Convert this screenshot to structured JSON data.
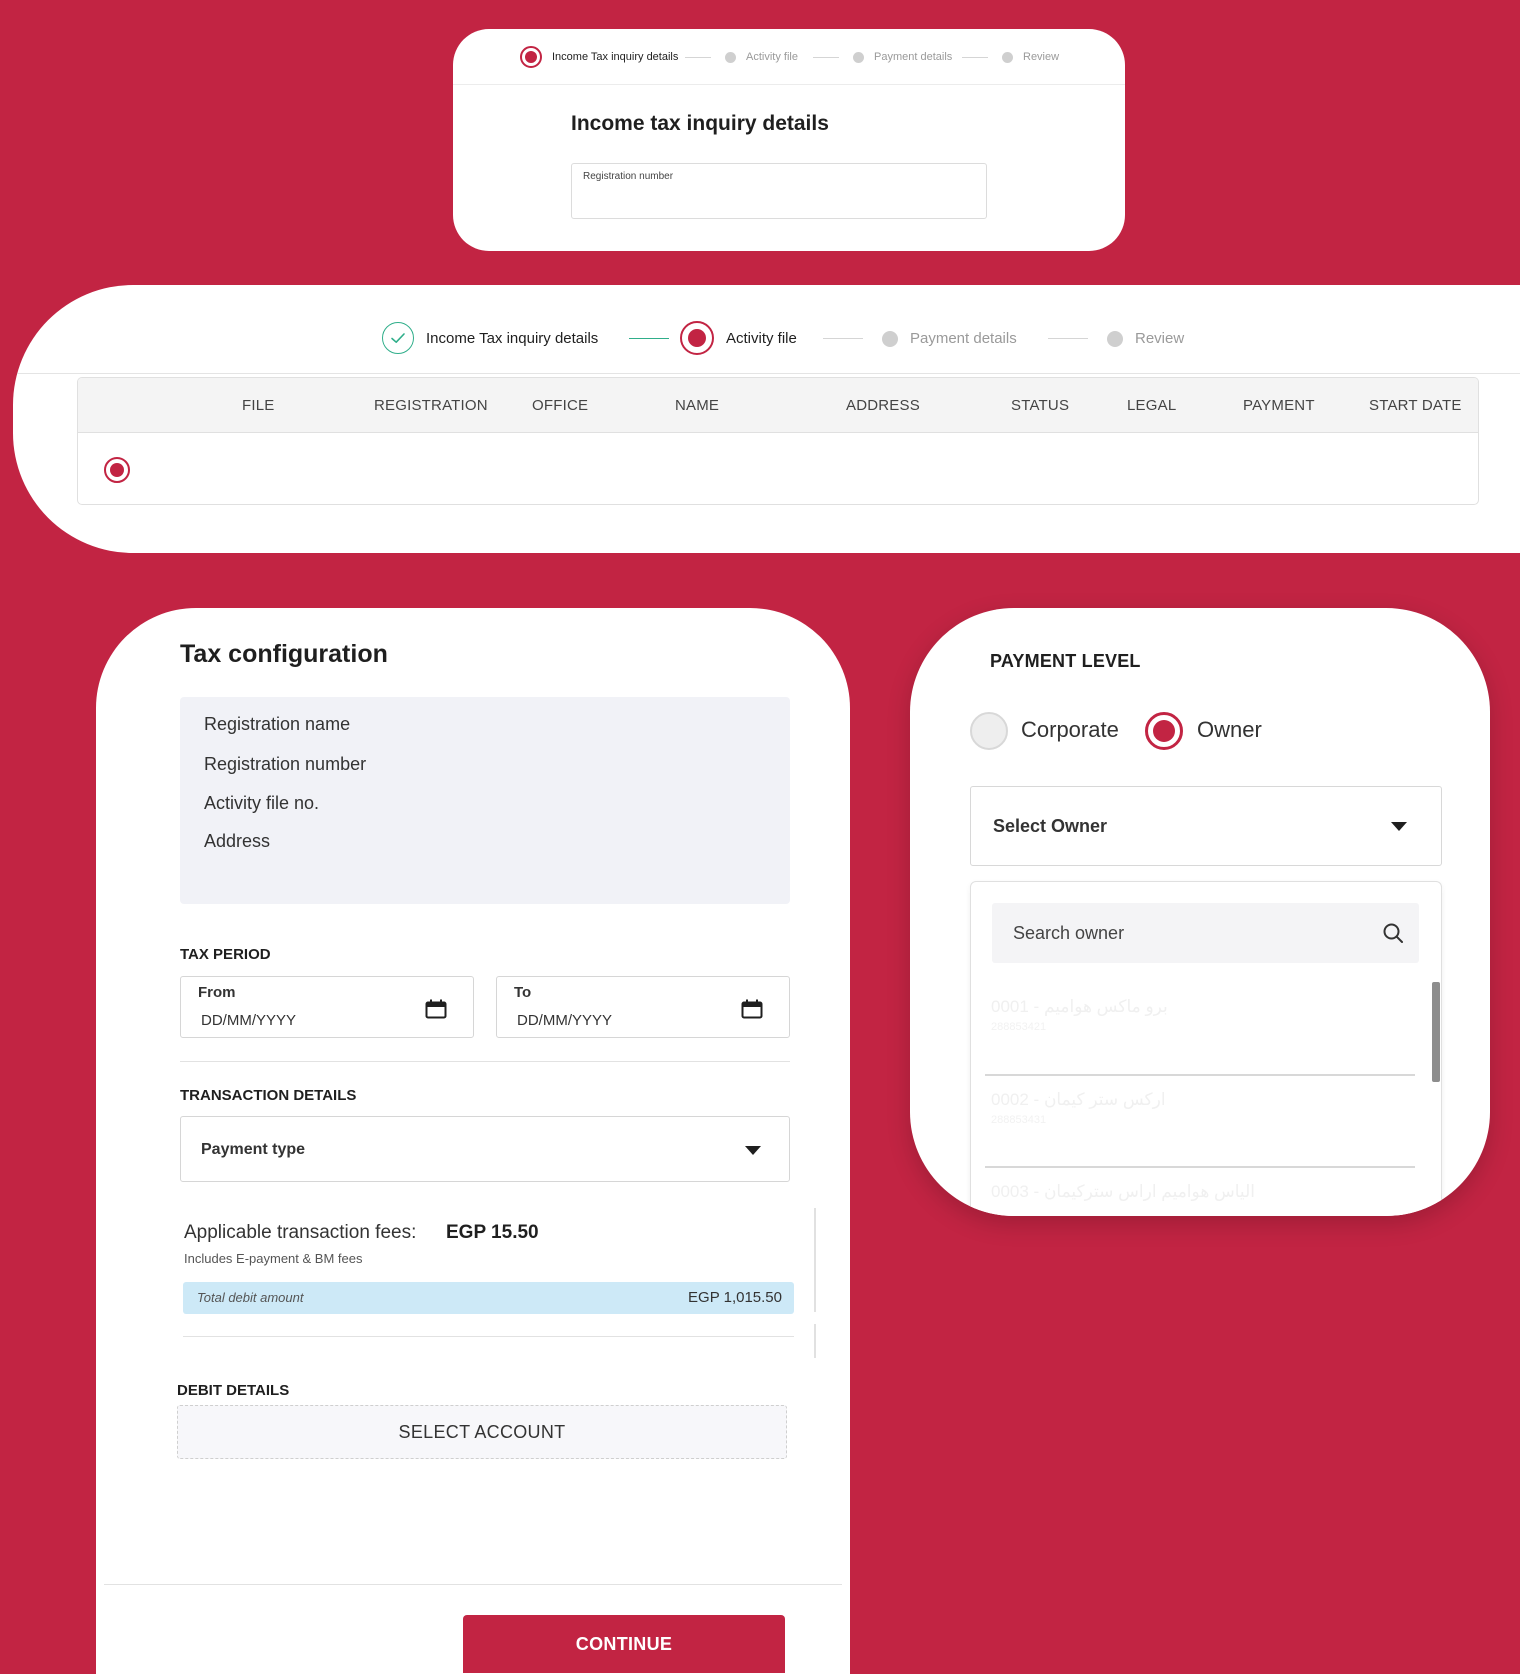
{
  "inquiry_card": {
    "steps": [
      {
        "label": "Income Tax inquiry details",
        "state": "active"
      },
      {
        "label": "Activity file",
        "state": "pending"
      },
      {
        "label": "Payment details",
        "state": "pending"
      },
      {
        "label": "Review",
        "state": "pending"
      }
    ],
    "title": "Income tax inquiry details",
    "registration_label": "Registration number"
  },
  "activity_card": {
    "steps": [
      {
        "label": "Income Tax inquiry details",
        "state": "done"
      },
      {
        "label": "Activity file",
        "state": "active"
      },
      {
        "label": "Payment details",
        "state": "pending"
      },
      {
        "label": "Review",
        "state": "pending"
      }
    ],
    "columns": [
      "FILE",
      "REGISTRATION",
      "OFFICE",
      "NAME",
      "ADDRESS",
      "STATUS",
      "LEGAL",
      "PAYMENT",
      "START DATE"
    ]
  },
  "tax_config": {
    "title": "Tax configuration",
    "info_items": [
      "Registration name",
      "Registration number",
      "Activity file no.",
      "Address"
    ],
    "tax_period_label": "TAX PERIOD",
    "from_label": "From",
    "from_placeholder": "DD/MM/YYYY",
    "to_label": "To",
    "to_placeholder": "DD/MM/YYYY",
    "transaction_label": "TRANSACTION DETAILS",
    "payment_type": "Payment type",
    "fees_label": "Applicable transaction fees:",
    "fees_value": "EGP 15.50",
    "fees_note": "Includes E-payment & BM fees",
    "total_label": "Total debit amount",
    "total_value": "EGP 1,015.50",
    "debit_label": "DEBIT DETAILS",
    "select_account": "SELECT ACCOUNT",
    "continue_label": "CONTINUE"
  },
  "payment_level": {
    "title": "PAYMENT LEVEL",
    "options": [
      {
        "label": "Corporate",
        "selected": false
      },
      {
        "label": "Owner",
        "selected": true
      }
    ],
    "select_owner": "Select Owner",
    "search_placeholder": "Search owner",
    "owners": [
      {
        "name": "0001 - برو ماكس هواميم",
        "id": "288853421"
      },
      {
        "name": "0002 - اركس ستر كيمان",
        "id": "288853431"
      },
      {
        "name": "0003 - الياس هواميم اراس ستركيمان",
        "id": ""
      }
    ]
  },
  "colors": {
    "brand": "#c22443",
    "success": "#2fae8a",
    "highlight": "#cde9f7"
  }
}
